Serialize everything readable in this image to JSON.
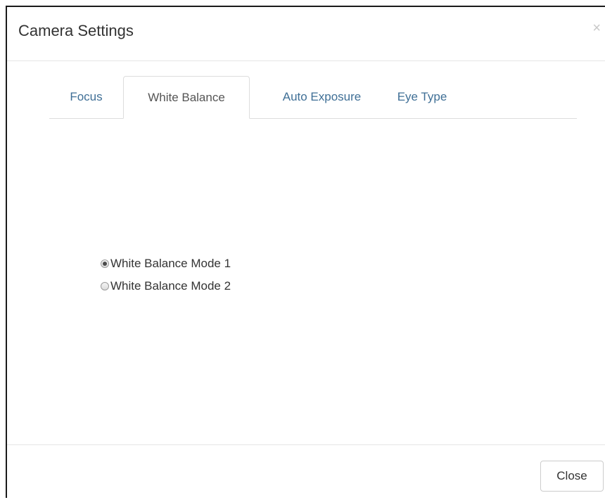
{
  "dialog": {
    "title": "Camera Settings",
    "close_glyph": "×",
    "close_icon": "close-icon"
  },
  "tabs": [
    {
      "label": "Focus",
      "active": false
    },
    {
      "label": "White Balance",
      "active": true
    },
    {
      "label": "Auto Exposure",
      "active": false
    },
    {
      "label": "Eye Type",
      "active": false
    }
  ],
  "white_balance": {
    "options": [
      {
        "label": "White Balance Mode 1",
        "checked": true
      },
      {
        "label": "White Balance Mode 2",
        "checked": false
      }
    ]
  },
  "footer": {
    "close_label": "Close"
  },
  "colors": {
    "tab_link": "#3f6f96",
    "text": "#333333",
    "border": "#dddddd"
  }
}
